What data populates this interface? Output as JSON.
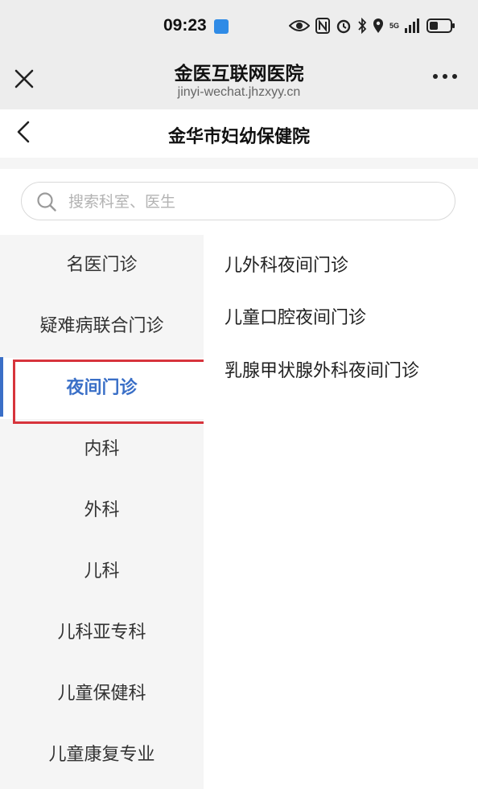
{
  "status_bar": {
    "time": "09:23",
    "network_label": "5G",
    "icons": [
      "eye-icon",
      "nfc-icon",
      "alarm-icon",
      "bluetooth-icon",
      "location-icon",
      "signal-icon",
      "battery-icon"
    ]
  },
  "wechat": {
    "title": "金医互联网医院",
    "url": "jinyi-wechat.jhzxyy.cn"
  },
  "page": {
    "title": "金华市妇幼保健院"
  },
  "search": {
    "placeholder": "搜索科室、医生"
  },
  "categories": [
    {
      "label": "名医门诊"
    },
    {
      "label": "疑难病联合门诊"
    },
    {
      "label": "夜间门诊"
    },
    {
      "label": "内科"
    },
    {
      "label": "外科"
    },
    {
      "label": "儿科"
    },
    {
      "label": "儿科亚专科"
    },
    {
      "label": "儿童保健科"
    },
    {
      "label": "儿童康复专业"
    }
  ],
  "active_category": "夜间门诊",
  "departments": [
    {
      "label": "儿外科夜间门诊"
    },
    {
      "label": "儿童口腔夜间门诊"
    },
    {
      "label": "乳腺甲状腺外科夜间门诊"
    }
  ],
  "colors": {
    "accent": "#3a6fc7",
    "highlight_border": "#d7343c",
    "sidebar_bg": "#f5f5f5",
    "header_bg": "#ededed"
  }
}
